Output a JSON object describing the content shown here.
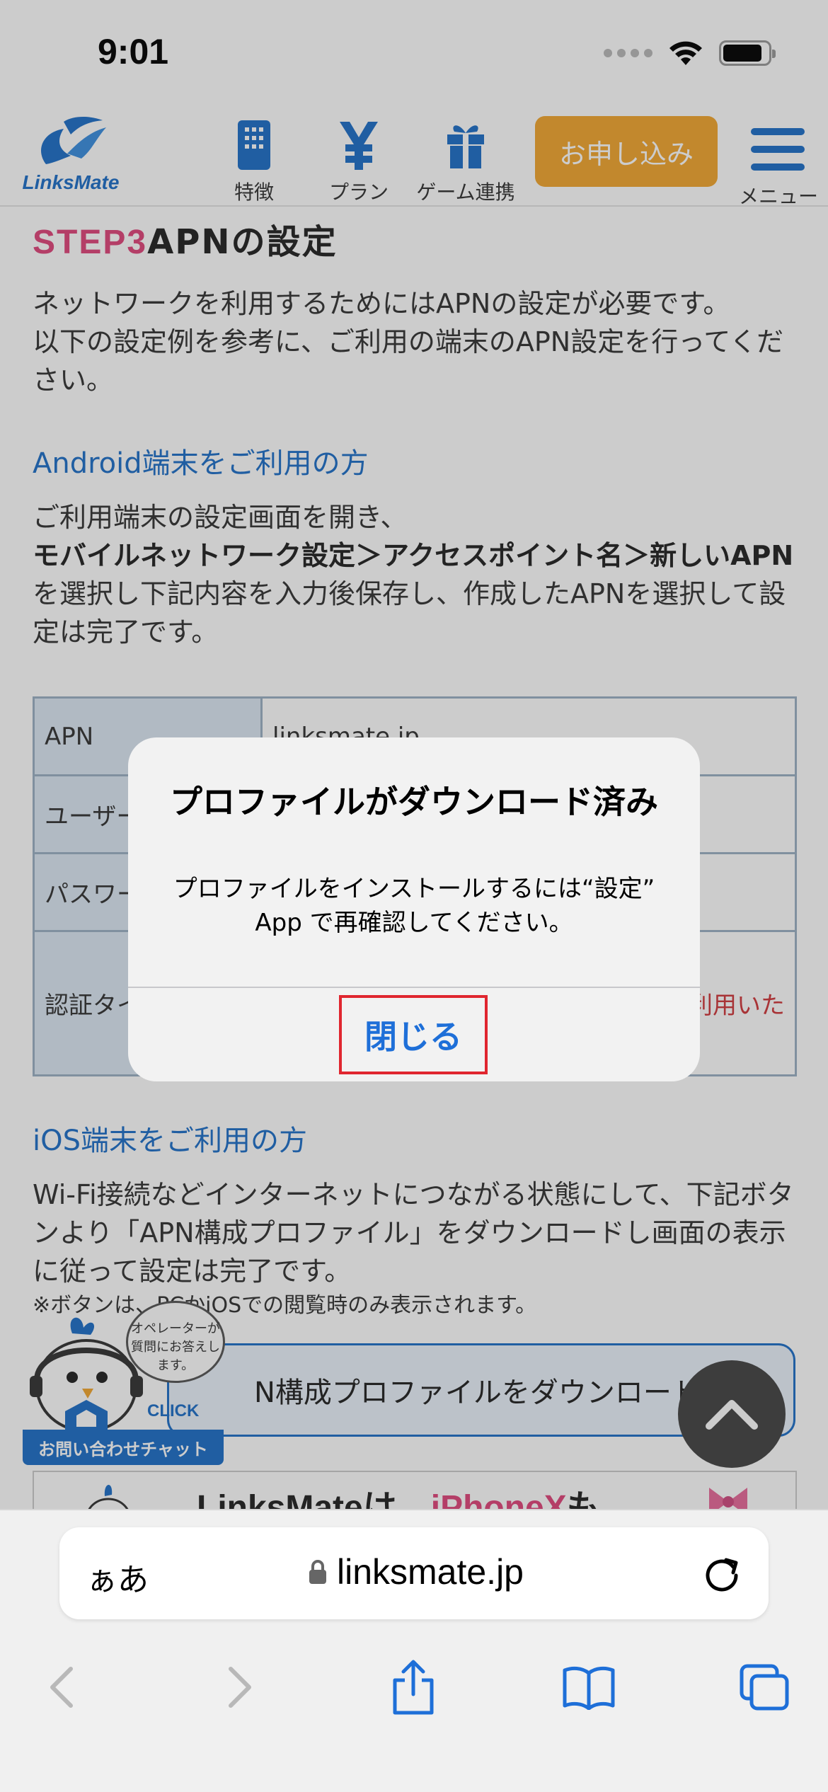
{
  "status_bar": {
    "time": "9:01"
  },
  "header": {
    "logo_text": "LinksMate",
    "nav": [
      {
        "label": "特徴",
        "icon": "building-icon"
      },
      {
        "label": "プラン",
        "icon": "yen-icon"
      },
      {
        "label": "ゲーム連携",
        "icon": "gift-icon"
      }
    ],
    "apply_label": "お申し込み",
    "menu_label": "メニュー"
  },
  "content": {
    "step_label": "STEP3",
    "step_title": "APNの設定",
    "intro_line1": "ネットワークを利用するためにはAPNの設定が必要です。",
    "intro_line2": "以下の設定例を参考に、ご利用の端末のAPN設定を行ってください。",
    "android_title": "Android端末をご利用の方",
    "android_line1": "ご利用端末の設定画面を開き、",
    "android_bold1": "モバイルネットワーク設定＞アクセスポイント名＞新しいAPN",
    "android_line2": "を選択し下記内容を入力後保存し、作成したAPNを選択して設定は完了です。",
    "table": {
      "rows": [
        {
          "key": "APN",
          "value": "linksmate.jp"
        },
        {
          "key": "ユーザー",
          "value": ""
        },
        {
          "key": "パスワー",
          "value": ""
        },
        {
          "key": "認証タイ",
          "value": "利用いた"
        }
      ]
    },
    "ios_title": "iOS端末をご利用の方",
    "ios_text": "Wi-Fi接続などインターネットにつながる状態にして、下記ボタンより「APN構成プロファイル」をダウンロードし画面の表示に従って設定は完了です。",
    "ios_note": "※ボタンは、PCかiOSでの閲覧時のみ表示されます。",
    "download_button": "N構成プロファイルをダウンロード",
    "banner_text_a": "LinksMateは、",
    "banner_text_b": "iPhoneX",
    "banner_text_c": "も"
  },
  "chat_widget": {
    "bubble_text": "オペレーターが質問にお答えします。",
    "click_label": "CLICK",
    "label": "お問い合わせチャット"
  },
  "alert": {
    "title": "プロファイルがダウンロード済み",
    "message": "プロファイルをインストールするには“設定” App で再確認してください。",
    "close_label": "閉じる"
  },
  "browser": {
    "aa_label": "ぁあ",
    "url": "linksmate.jp"
  },
  "colors": {
    "brand_blue": "#1e6fc8",
    "apply_orange": "#f2a62f",
    "step_pink": "#e0457b",
    "alert_button_blue": "#1e6fd8",
    "highlight_red": "#e0262f"
  }
}
